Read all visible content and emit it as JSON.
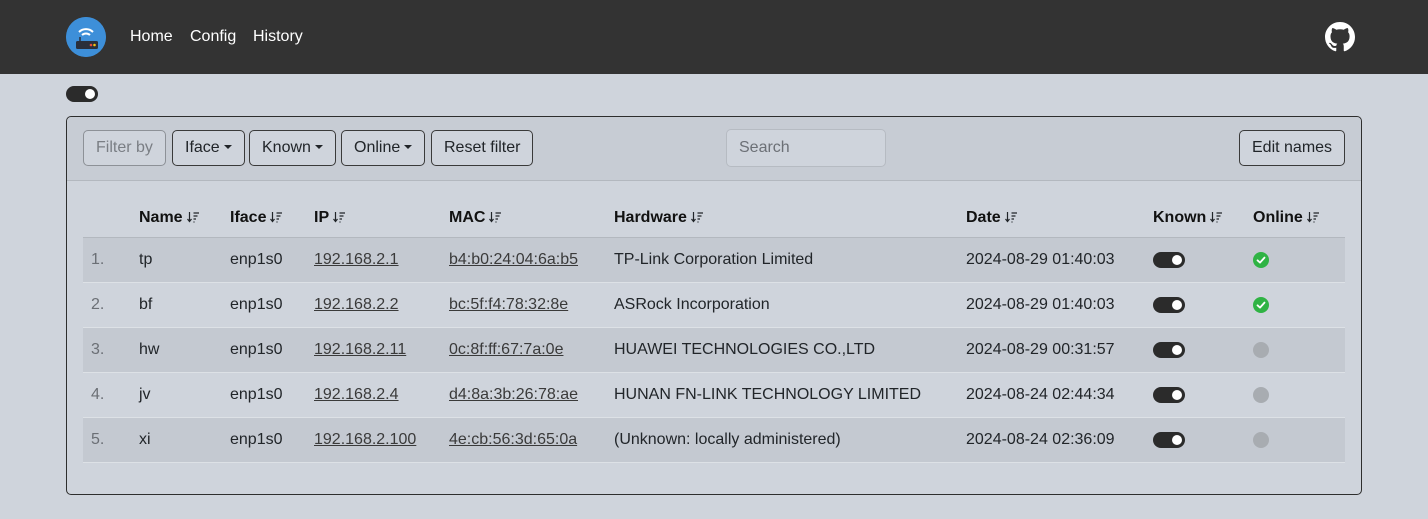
{
  "nav": {
    "links": [
      "Home",
      "Config",
      "History"
    ]
  },
  "colors": {
    "navbar": "#333333",
    "background": "#cfd4dc",
    "online": "#2fb344",
    "offline": "#a8acb1"
  },
  "toolbar": {
    "filter_by": "Filter by",
    "iface": "Iface",
    "known": "Known",
    "online": "Online",
    "reset": "Reset filter",
    "search_placeholder": "Search",
    "edit_names": "Edit names"
  },
  "table": {
    "headers": [
      "Name",
      "Iface",
      "IP",
      "MAC",
      "Hardware",
      "Date",
      "Known",
      "Online"
    ],
    "rows": [
      {
        "index": "1.",
        "name": "tp",
        "iface": "enp1s0",
        "ip": "192.168.2.1",
        "mac": "b4:b0:24:04:6a:b5",
        "hardware": "TP-Link Corporation Limited",
        "date": "2024-08-29 01:40:03",
        "known": true,
        "online": true
      },
      {
        "index": "2.",
        "name": "bf",
        "iface": "enp1s0",
        "ip": "192.168.2.2",
        "mac": "bc:5f:f4:78:32:8e",
        "hardware": "ASRock Incorporation",
        "date": "2024-08-29 01:40:03",
        "known": true,
        "online": true
      },
      {
        "index": "3.",
        "name": "hw",
        "iface": "enp1s0",
        "ip": "192.168.2.11",
        "mac": "0c:8f:ff:67:7a:0e",
        "hardware": "HUAWEI TECHNOLOGIES CO.,LTD",
        "date": "2024-08-29 00:31:57",
        "known": true,
        "online": false
      },
      {
        "index": "4.",
        "name": "jv",
        "iface": "enp1s0",
        "ip": "192.168.2.4",
        "mac": "d4:8a:3b:26:78:ae",
        "hardware": "HUNAN FN-LINK TECHNOLOGY LIMITED",
        "date": "2024-08-24 02:44:34",
        "known": true,
        "online": false
      },
      {
        "index": "5.",
        "name": "xi",
        "iface": "enp1s0",
        "ip": "192.168.2.100",
        "mac": "4e:cb:56:3d:65:0a",
        "hardware": "(Unknown: locally administered)",
        "date": "2024-08-24 02:36:09",
        "known": true,
        "online": false
      }
    ]
  }
}
